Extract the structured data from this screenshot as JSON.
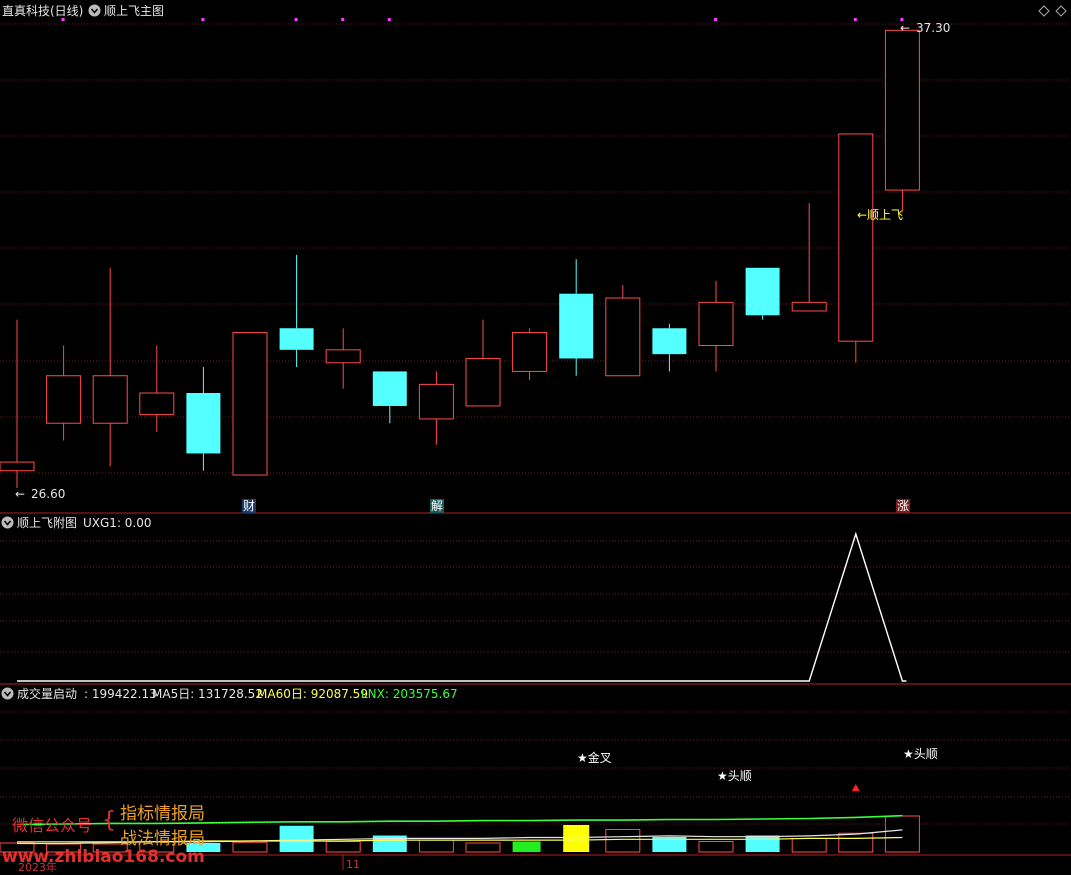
{
  "main_panel": {
    "title": "直真科技(日线)",
    "indicator": "顺上飞主图",
    "price_high_label": "37.30",
    "price_low_label": "26.60",
    "signal_label": "←顺上飞",
    "event_tags": [
      "财",
      "解",
      "涨"
    ]
  },
  "sub_panel": {
    "title": "顺上飞附图",
    "value_label": "UXG1: 0.00"
  },
  "volume_panel": {
    "title": "成交量启动",
    "main_value": ": 199422.13",
    "ma5": "MA5日: 131728.52",
    "ma60": "MA60日: 92087.59",
    "lnx": "LNX: 203575.67",
    "annotations": [
      "★金叉",
      "★头顺"
    ],
    "annotation_right": "★头顺"
  },
  "axis": {
    "year_label": "2023年",
    "month_label": "11"
  },
  "watermark": {
    "wechat": "微信公众号",
    "line1": "指标情报局",
    "line2": "战法情报局",
    "url": "www.zhibiao168.com"
  },
  "colors": {
    "up": "#ff4b4b",
    "down": "#54ffff",
    "grid": "#7a1a1a",
    "text_white": "#e6e6e6",
    "text_yellow": "#ffff54",
    "ma_green": "#3bff3b",
    "magenta": "#ff3bff"
  },
  "chart_data": {
    "type": "candlestick",
    "price_range": [
      26.6,
      37.3
    ],
    "candles": [
      {
        "o": 27.0,
        "c": 27.2,
        "h": 30.5,
        "l": 26.6
      },
      {
        "o": 28.1,
        "c": 29.2,
        "h": 29.9,
        "l": 27.7
      },
      {
        "o": 28.1,
        "c": 29.2,
        "h": 31.7,
        "l": 27.1
      },
      {
        "o": 28.3,
        "c": 28.8,
        "h": 29.9,
        "l": 27.9
      },
      {
        "o": 28.8,
        "c": 27.4,
        "h": 29.4,
        "l": 27.0
      },
      {
        "o": 26.9,
        "c": 30.2,
        "h": 30.2,
        "l": 26.9
      },
      {
        "o": 30.3,
        "c": 29.8,
        "h": 32.0,
        "l": 29.4
      },
      {
        "o": 29.5,
        "c": 29.8,
        "h": 30.3,
        "l": 28.9
      },
      {
        "o": 29.3,
        "c": 28.5,
        "h": 29.3,
        "l": 28.1
      },
      {
        "o": 28.2,
        "c": 29.0,
        "h": 29.3,
        "l": 27.6
      },
      {
        "o": 28.5,
        "c": 29.6,
        "h": 30.5,
        "l": 28.5
      },
      {
        "o": 29.3,
        "c": 30.2,
        "h": 30.3,
        "l": 29.1
      },
      {
        "o": 31.1,
        "c": 29.6,
        "h": 31.9,
        "l": 29.2
      },
      {
        "o": 29.2,
        "c": 31.0,
        "h": 31.3,
        "l": 29.2
      },
      {
        "o": 30.3,
        "c": 29.7,
        "h": 30.4,
        "l": 29.3
      },
      {
        "o": 29.9,
        "c": 30.9,
        "h": 31.4,
        "l": 29.3
      },
      {
        "o": 31.7,
        "c": 30.6,
        "h": 31.7,
        "l": 30.5
      },
      {
        "o": 30.7,
        "c": 30.9,
        "h": 33.2,
        "l": 30.7
      },
      {
        "o": 30.0,
        "c": 34.8,
        "h": 34.8,
        "l": 29.5
      },
      {
        "o": 33.5,
        "c": 37.2,
        "h": 37.3,
        "l": 33.0
      }
    ],
    "event_tag_indices": [
      5,
      9,
      19
    ],
    "signal_index": 19,
    "uxg1": [
      0,
      0,
      0,
      0,
      0,
      0,
      0,
      0,
      0,
      0,
      0,
      0,
      0,
      0,
      0,
      0,
      0,
      0,
      1,
      0
    ],
    "volume": [
      0.12,
      0.1,
      0.1,
      0.14,
      0.12,
      0.13,
      0.35,
      0.14,
      0.22,
      0.16,
      0.12,
      0.14,
      0.28,
      0.3,
      0.2,
      0.14,
      0.22,
      0.18,
      0.25,
      0.48
    ],
    "volume_colors": [
      "up",
      "up",
      "up",
      "up",
      "down",
      "up",
      "down",
      "up",
      "down",
      "up",
      "up",
      "green",
      "yellow",
      "up",
      "down",
      "up",
      "down",
      "up",
      "up",
      "up"
    ],
    "ma5_line": [
      0.1,
      0.1,
      0.11,
      0.12,
      0.12,
      0.13,
      0.14,
      0.15,
      0.16,
      0.16,
      0.16,
      0.17,
      0.17,
      0.18,
      0.19,
      0.18,
      0.18,
      0.19,
      0.21,
      0.26
    ],
    "ma60_line": [
      0.12,
      0.12,
      0.12,
      0.12,
      0.13,
      0.13,
      0.13,
      0.13,
      0.14,
      0.14,
      0.14,
      0.14,
      0.14,
      0.15,
      0.15,
      0.15,
      0.15,
      0.16,
      0.16,
      0.17
    ],
    "lnx_line": [
      0.5,
      0.51,
      0.52,
      0.52,
      0.53,
      0.54,
      0.55,
      0.55,
      0.56,
      0.56,
      0.57,
      0.57,
      0.58,
      0.58,
      0.59,
      0.59,
      0.6,
      0.61,
      0.63,
      0.66
    ],
    "purple_dot_indices": [
      1,
      4,
      6,
      7,
      8,
      15,
      18,
      19
    ]
  }
}
